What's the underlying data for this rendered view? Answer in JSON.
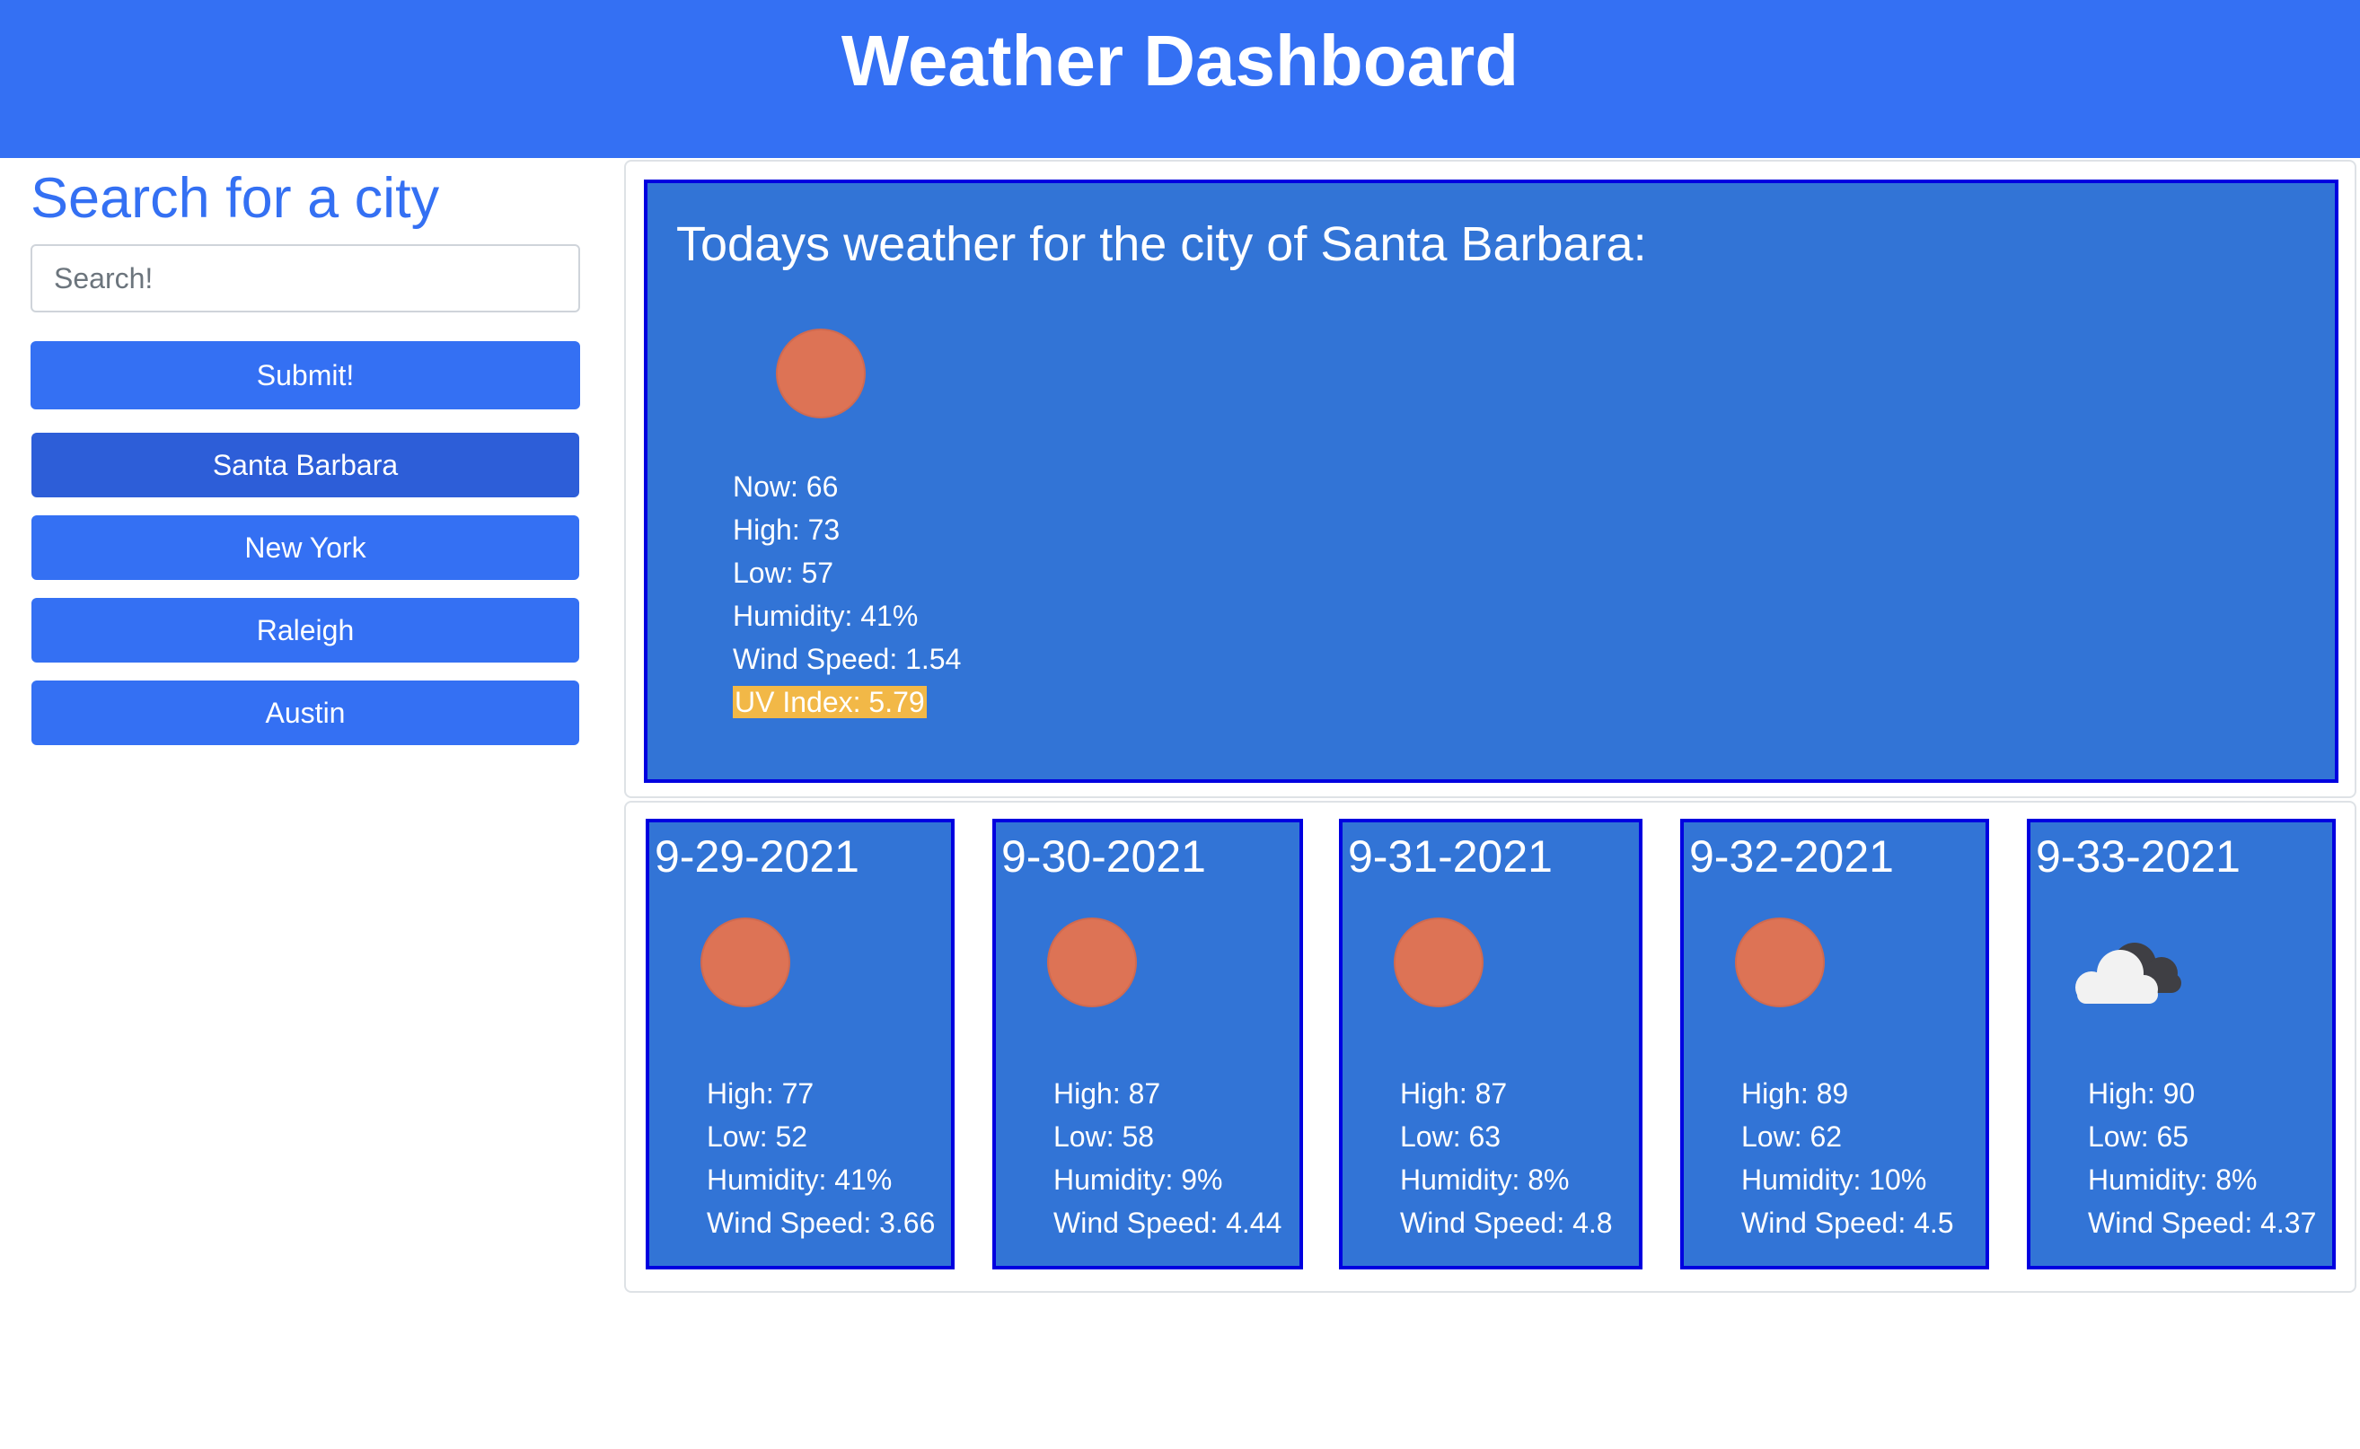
{
  "header": {
    "title": "Weather Dashboard"
  },
  "sidebar": {
    "heading": "Search for a city",
    "search_placeholder": "Search!",
    "submit_label": "Submit!",
    "history": [
      {
        "label": "Santa Barbara"
      },
      {
        "label": "New York"
      },
      {
        "label": "Raleigh"
      },
      {
        "label": "Austin"
      }
    ]
  },
  "today": {
    "title": "Todays weather for the city of Santa Barbara:",
    "icon": "sun-icon",
    "now": "Now: 66",
    "high": "High: 73",
    "low": "Low: 57",
    "humidity": "Humidity: 41%",
    "wind": "Wind Speed: 1.54",
    "uv": "UV Index: 5.79"
  },
  "forecast": [
    {
      "date": "9-29-2021",
      "icon": "sun-icon",
      "high": "High: 77",
      "low": "Low: 52",
      "humidity": "Humidity: 41%",
      "wind": "Wind Speed: 3.66"
    },
    {
      "date": "9-30-2021",
      "icon": "sun-icon",
      "high": "High: 87",
      "low": "Low: 58",
      "humidity": "Humidity: 9%",
      "wind": "Wind Speed: 4.44"
    },
    {
      "date": "9-31-2021",
      "icon": "sun-icon",
      "high": "High: 87",
      "low": "Low: 63",
      "humidity": "Humidity: 8%",
      "wind": "Wind Speed: 4.8"
    },
    {
      "date": "9-32-2021",
      "icon": "sun-icon",
      "high": "High: 89",
      "low": "Low: 62",
      "humidity": "Humidity: 10%",
      "wind": "Wind Speed: 4.5"
    },
    {
      "date": "9-33-2021",
      "icon": "cloud-icon",
      "high": "High: 90",
      "low": "Low: 65",
      "humidity": "Humidity: 8%",
      "wind": "Wind Speed: 4.37"
    }
  ],
  "colors": {
    "header_bg": "#3470f3",
    "card_bg": "#3274d6",
    "card_border": "#0000e0",
    "sun": "#dd7355",
    "uv_highlight": "#f2b847",
    "active_history": "#2d5ed8"
  }
}
